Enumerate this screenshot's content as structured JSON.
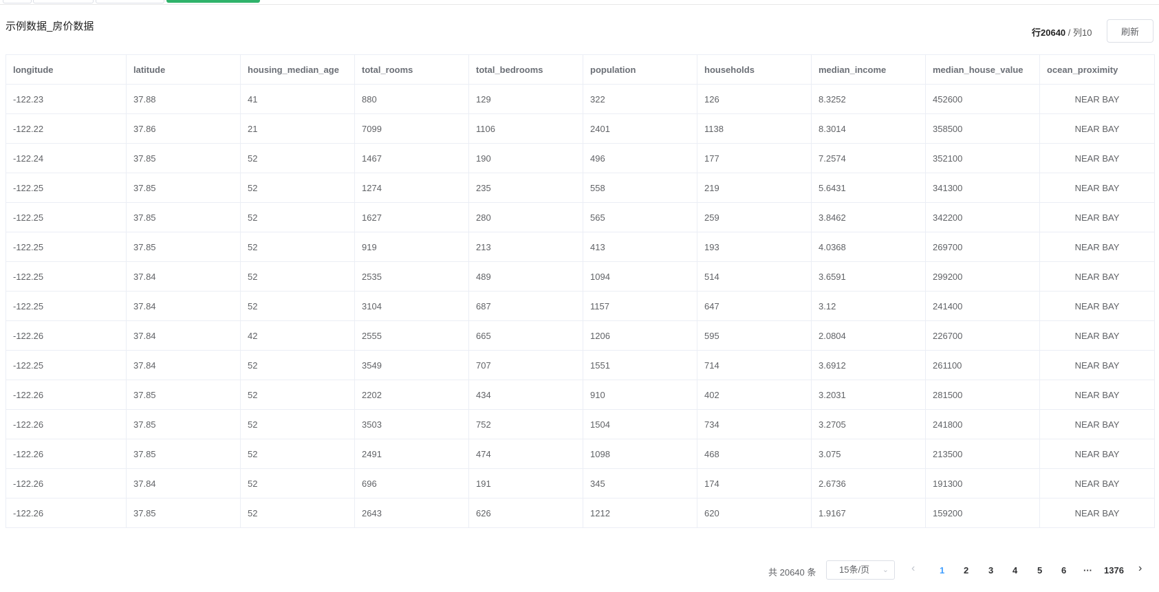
{
  "title": "示例数据_房价数据",
  "stats": {
    "rows_label": "行",
    "rows": "20640",
    "sep": " / ",
    "cols_label": "列",
    "cols": "10"
  },
  "refresh_label": "刷新",
  "columns": [
    "longitude",
    "latitude",
    "housing_median_age",
    "total_rooms",
    "total_bedrooms",
    "population",
    "households",
    "median_income",
    "median_house_value",
    "ocean_proximity"
  ],
  "rows": [
    [
      "-122.23",
      "37.88",
      "41",
      "880",
      "129",
      "322",
      "126",
      "8.3252",
      "452600",
      "NEAR BAY"
    ],
    [
      "-122.22",
      "37.86",
      "21",
      "7099",
      "1106",
      "2401",
      "1138",
      "8.3014",
      "358500",
      "NEAR BAY"
    ],
    [
      "-122.24",
      "37.85",
      "52",
      "1467",
      "190",
      "496",
      "177",
      "7.2574",
      "352100",
      "NEAR BAY"
    ],
    [
      "-122.25",
      "37.85",
      "52",
      "1274",
      "235",
      "558",
      "219",
      "5.6431",
      "341300",
      "NEAR BAY"
    ],
    [
      "-122.25",
      "37.85",
      "52",
      "1627",
      "280",
      "565",
      "259",
      "3.8462",
      "342200",
      "NEAR BAY"
    ],
    [
      "-122.25",
      "37.85",
      "52",
      "919",
      "213",
      "413",
      "193",
      "4.0368",
      "269700",
      "NEAR BAY"
    ],
    [
      "-122.25",
      "37.84",
      "52",
      "2535",
      "489",
      "1094",
      "514",
      "3.6591",
      "299200",
      "NEAR BAY"
    ],
    [
      "-122.25",
      "37.84",
      "52",
      "3104",
      "687",
      "1157",
      "647",
      "3.12",
      "241400",
      "NEAR BAY"
    ],
    [
      "-122.26",
      "37.84",
      "42",
      "2555",
      "665",
      "1206",
      "595",
      "2.0804",
      "226700",
      "NEAR BAY"
    ],
    [
      "-122.25",
      "37.84",
      "52",
      "3549",
      "707",
      "1551",
      "714",
      "3.6912",
      "261100",
      "NEAR BAY"
    ],
    [
      "-122.26",
      "37.85",
      "52",
      "2202",
      "434",
      "910",
      "402",
      "3.2031",
      "281500",
      "NEAR BAY"
    ],
    [
      "-122.26",
      "37.85",
      "52",
      "3503",
      "752",
      "1504",
      "734",
      "3.2705",
      "241800",
      "NEAR BAY"
    ],
    [
      "-122.26",
      "37.85",
      "52",
      "2491",
      "474",
      "1098",
      "468",
      "3.075",
      "213500",
      "NEAR BAY"
    ],
    [
      "-122.26",
      "37.84",
      "52",
      "696",
      "191",
      "345",
      "174",
      "2.6736",
      "191300",
      "NEAR BAY"
    ],
    [
      "-122.26",
      "37.85",
      "52",
      "2643",
      "626",
      "1212",
      "620",
      "1.9167",
      "159200",
      "NEAR BAY"
    ]
  ],
  "pagination": {
    "total_text": "共 20640 条",
    "page_size": "15条/页",
    "pages": [
      "1",
      "2",
      "3",
      "4",
      "5",
      "6"
    ],
    "ellipsis": "···",
    "last_page": "1376",
    "current": "1"
  },
  "colors": {
    "accent": "#2fb36b",
    "link": "#409eff"
  },
  "icons": {
    "prev": "chevron-left-icon",
    "next": "chevron-right-icon",
    "dropdown": "chevron-down-icon"
  }
}
